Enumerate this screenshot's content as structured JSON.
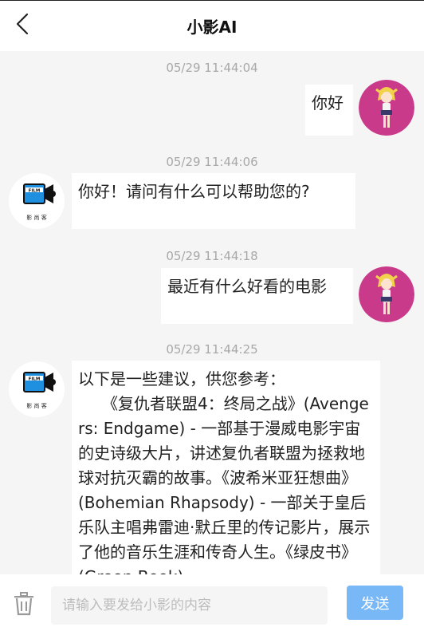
{
  "header": {
    "title": "小影AI"
  },
  "messages": [
    {
      "time": "05/29 11:44:04",
      "sender": "user",
      "text": "你好"
    },
    {
      "time": "05/29 11:44:06",
      "sender": "bot",
      "text": "你好！请问有什么可以帮助您的?"
    },
    {
      "time": "05/29 11:44:18",
      "sender": "user",
      "text": "最近有什么好看的电影"
    },
    {
      "time": "05/29 11:44:25",
      "sender": "bot",
      "text": "以下是一些建议，供您参考：\n　　《复仇者联盟4：终局之战》(Avengers: Endgame) - 一部基于漫威电影宇宙的史诗级大片，讲述复仇者联盟为拯救地球对抗灭霸的故事。《波希米亚狂想曲》(Bohemian Rhapsody) - 一部关于皇后乐队主唱弗雷迪·默丘里的传记影片，展示了他的音乐生涯和传奇人生。《绿皮书》(Green Book)"
    }
  ],
  "bot_logo": {
    "film_text": "FILM",
    "caption": "影 尚 客"
  },
  "input": {
    "placeholder": "请输入要发给小影的内容",
    "value": ""
  },
  "send_label": "发送",
  "colors": {
    "accent": "#79b8f7",
    "user_avatar_bg": "#c93a8a",
    "bot_logo_blue": "#1f8fe0"
  }
}
